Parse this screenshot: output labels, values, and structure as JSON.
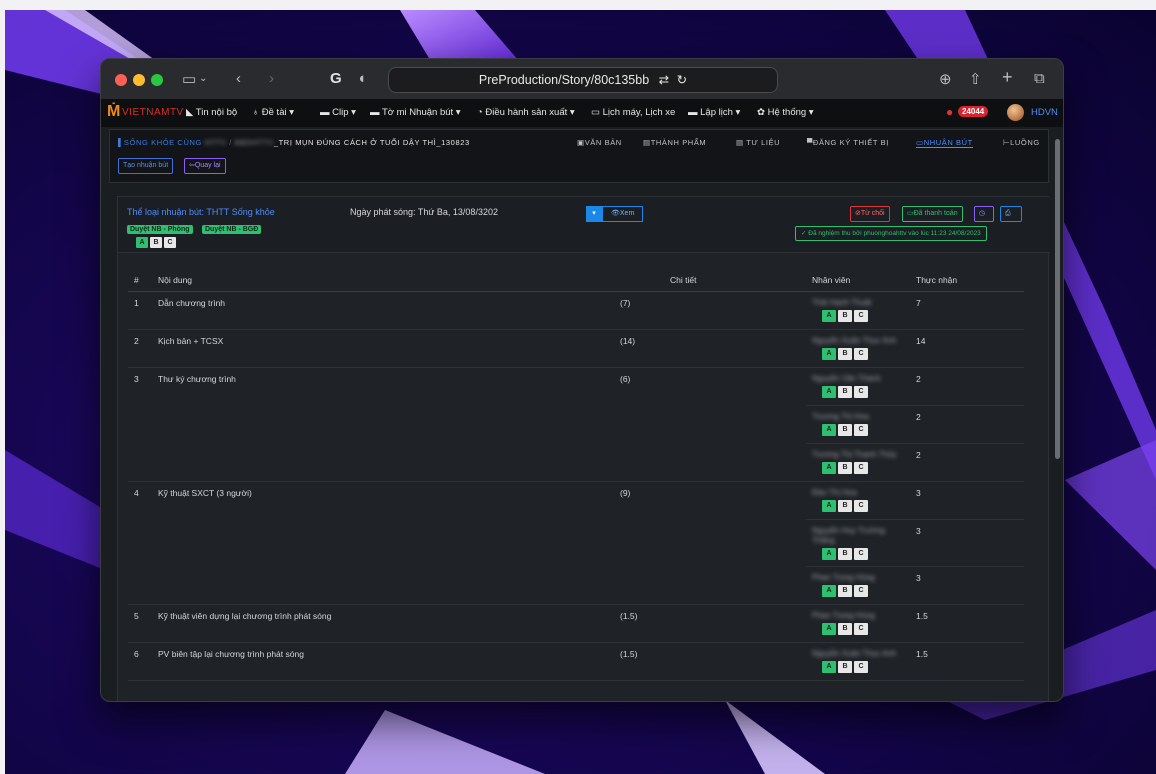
{
  "browser": {
    "url": "PreProduction/Story/80c135bb",
    "translate_icon": "translate-icon"
  },
  "nav": {
    "logo_text": "VIETNAMTV",
    "items": [
      "Tin nội bộ",
      "Đề tài ▾",
      "Clip ▾",
      "Tờ mi Nhuận bút ▾",
      "Điều hành sản xuất ▾",
      "Lịch máy, Lịch xe",
      "Lập lịch ▾",
      "Hệ thống ▾"
    ],
    "badge": "24044",
    "user": "HDVN"
  },
  "subbar": {
    "crumb_program": "SỐNG KHỎE CÙNG",
    "crumb_blur1": "HTTV",
    "crumb_blur2": "BBDHTTV",
    "crumb_title": "_TRỊ MỤN ĐÚNG CÁCH Ở TUỔI DẬY THÌ_130823",
    "tabs": [
      "VĂN BẢN",
      "THÀNH PHẨM",
      "TƯ LIỆU",
      "ĐĂNG KÝ THIẾT BỊ",
      "NHUẬN BÚT",
      "LUỒNG"
    ],
    "btn_create": "Tạo nhuận bút",
    "btn_back": "⇦Quay lại"
  },
  "header": {
    "category": "Thể loại nhuận bút: THTT Sống khỏe",
    "airdate": "Ngày phát sóng: Thứ Ba, 13/08/3202",
    "tag1": "Duyệt NB - Phòng",
    "tag2": "Duyệt NB - BGĐ",
    "view_btn": "👁Xem",
    "reject": "⊘Từ chối",
    "paid": "▭Đã thanh toán",
    "note": "✓ Đã nghiệm thu bởi phuonghoahttv vào lúc 11:23 24/08/2023"
  },
  "table": {
    "headers": [
      "#",
      "Nội dung",
      "Chi tiết",
      "Nhân viên",
      "Thực nhận"
    ],
    "rows": [
      {
        "num": "1",
        "content": "Dẫn chương trình",
        "detail": "(7)",
        "staff": [
          {
            "name": "Thái Hạnh Thuật",
            "amount": "7"
          }
        ]
      },
      {
        "num": "2",
        "content": "Kịch bản + TCSX",
        "detail": "(14)",
        "staff": [
          {
            "name": "Nguyễn Xuân Thục Anh",
            "amount": "14"
          }
        ]
      },
      {
        "num": "3",
        "content": "Thư ký chương trình",
        "detail": "(6)",
        "staff": [
          {
            "name": "Nguyễn Văn Thành",
            "amount": "2"
          },
          {
            "name": "Trương Thị Hoa",
            "amount": "2"
          },
          {
            "name": "Trương Thị Thanh Thủy",
            "amount": "2"
          }
        ]
      },
      {
        "num": "4",
        "content": "Kỹ thuật SXCT (3 người)",
        "detail": "(9)",
        "staff": [
          {
            "name": "Đào Thị Hoa",
            "amount": "3"
          },
          {
            "name": "Nguyễn Huy Trường Thắng",
            "amount": "3"
          },
          {
            "name": "Phan Trọng Hùng",
            "amount": "3"
          }
        ]
      },
      {
        "num": "5",
        "content": "Kỹ thuật viên dựng lại chương trình phát sóng",
        "detail": "(1.5)",
        "staff": [
          {
            "name": "Phan Trọng Hùng",
            "amount": "1.5"
          }
        ]
      },
      {
        "num": "6",
        "content": "PV biên tập lại chương trình phát sóng",
        "detail": "(1.5)",
        "staff": [
          {
            "name": "Nguyễn Xuân Thục Anh",
            "amount": "1.5"
          }
        ]
      }
    ]
  }
}
